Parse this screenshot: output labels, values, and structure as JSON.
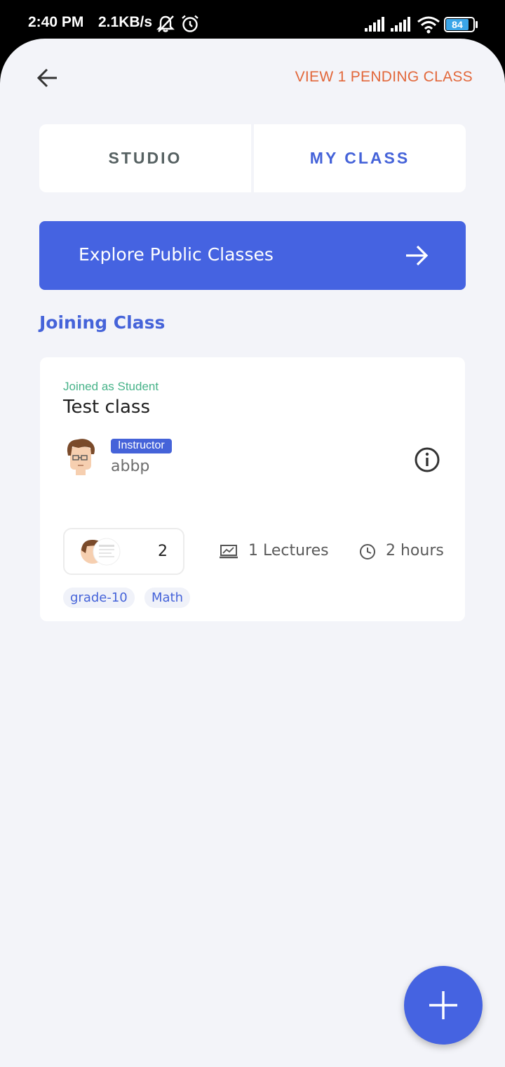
{
  "status_bar": {
    "time": "2:40 PM",
    "net_speed": "2.1KB/s",
    "battery": "84",
    "icons": [
      "bell-muted-icon",
      "alarm-icon",
      "signal-icon",
      "signal-icon",
      "wifi-icon",
      "battery-icon"
    ]
  },
  "header": {
    "back_icon": "arrow-left-icon",
    "pending_link": "VIEW 1 PENDING CLASS",
    "pending_color": "#e2673a"
  },
  "tabs": [
    {
      "label": "STUDIO",
      "active": false
    },
    {
      "label": "MY CLASS",
      "active": true
    }
  ],
  "explore": {
    "label": "Explore Public Classes",
    "icon": "arrow-right-icon",
    "color": "#4563e1"
  },
  "section": {
    "title": "Joining Class"
  },
  "class_card": {
    "role": "Joined as Student",
    "title": "Test class",
    "instructor_badge": "Instructor",
    "instructor_name": "abbp",
    "info_icon": "info-icon",
    "member_count": "2",
    "lectures": "1 Lectures",
    "duration": "2 hours",
    "tags": [
      "grade-10",
      "Math"
    ]
  },
  "fab": {
    "icon": "plus-icon"
  },
  "colors": {
    "accent": "#4563d9",
    "background": "#f3f4f9",
    "joined_green": "#47b389"
  }
}
